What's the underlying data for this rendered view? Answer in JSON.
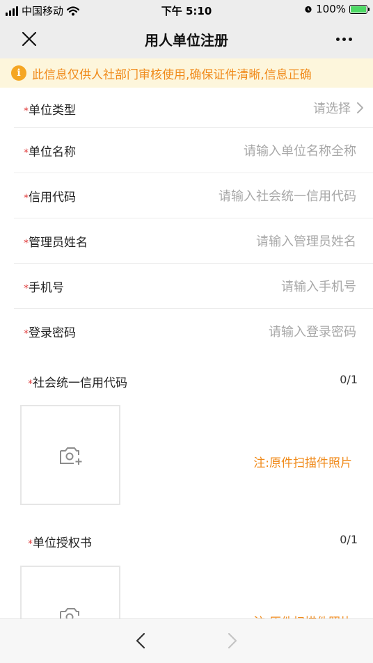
{
  "status_bar": {
    "carrier": "中国移动",
    "time": "下午 5:10",
    "battery": "100%",
    "battery_color": "#4cd964"
  },
  "nav": {
    "title": "用人单位注册",
    "close_icon": "close-icon",
    "more_icon": "more-icon"
  },
  "notice": {
    "icon": "i",
    "text": "此信息仅供人社部门审核使用,确保证件清晰,信息正确",
    "color": "#f08a1a"
  },
  "form": {
    "required_mark": "*",
    "fields": [
      {
        "label": "单位类型",
        "placeholder": "请选择"
      },
      {
        "label": "单位名称",
        "placeholder": "请输入单位名称全称"
      },
      {
        "label": "信用代码",
        "placeholder": "请输入社会统一信用代码"
      },
      {
        "label": "管理员姓名",
        "placeholder": "请输入管理员姓名"
      },
      {
        "label": "手机号",
        "placeholder": "请输入手机号"
      },
      {
        "label": "登录密码",
        "placeholder": "请输入登录密码"
      }
    ]
  },
  "uploads": [
    {
      "label": "社会统一信用代码",
      "count": "0/1",
      "note": "注:原件扫描件照片"
    },
    {
      "label": "单位授权书",
      "count": "0/1",
      "note": "注:原件扫描件照片"
    }
  ]
}
